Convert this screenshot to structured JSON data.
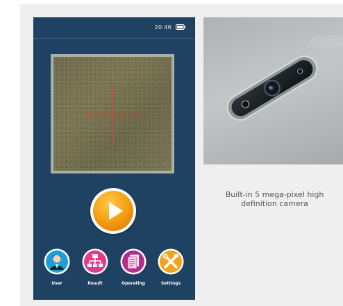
{
  "status_bar": {
    "time": "20:46",
    "battery_icon": "battery-icon"
  },
  "preview": {
    "crosshair_icon": "crosshair-icon",
    "crosshair_color": "#e43a32"
  },
  "play_button": {
    "icon": "play-icon",
    "color": "#f5a013"
  },
  "nav": {
    "items": [
      {
        "label": "User",
        "icon": "user-icon",
        "color": "#1d9ed8"
      },
      {
        "label": "Result",
        "icon": "result-icon",
        "color": "#e23a8c"
      },
      {
        "label": "Operating",
        "icon": "operating-icon",
        "color": "#b42f8c"
      },
      {
        "label": "Settings",
        "icon": "settings-icon",
        "color": "#f4a31c"
      }
    ]
  },
  "caption": {
    "line1": "Built-in 5 mega-pixel high",
    "line2": "definition camera"
  },
  "colors": {
    "phone_background": "#1f4262",
    "panel_background": "#efefef"
  }
}
